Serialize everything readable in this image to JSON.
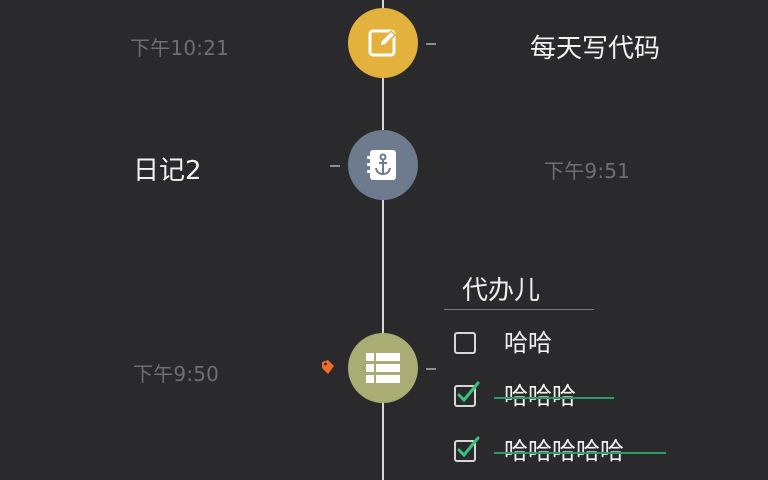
{
  "timeline": {
    "entries": [
      {
        "time": "下午10:21",
        "title": "每天写代码",
        "icon": "edit-note-icon",
        "color": "#e3b23c"
      },
      {
        "time": "下午9:51",
        "title": "日记2",
        "icon": "anchor-notebook-icon",
        "color": "#6e7b8f"
      },
      {
        "time": "下午9:50",
        "icon": "list-icon",
        "color": "#a9ad74",
        "tag_icon": "tag-icon",
        "tag_color": "#f06c2b",
        "todo": {
          "title": "代办儿",
          "items": [
            {
              "text": "哈哈",
              "checked": false
            },
            {
              "text": "哈哈哈",
              "checked": true
            },
            {
              "text": "哈哈哈哈哈",
              "checked": true
            }
          ]
        }
      }
    ]
  },
  "colors": {
    "background": "#2a292b",
    "timeline_line": "#d8d8d8",
    "time_text": "#6f6f6f",
    "title_text": "#f2f2f2",
    "check_mark": "#37c27f",
    "strike_line": "#2f9a66"
  }
}
